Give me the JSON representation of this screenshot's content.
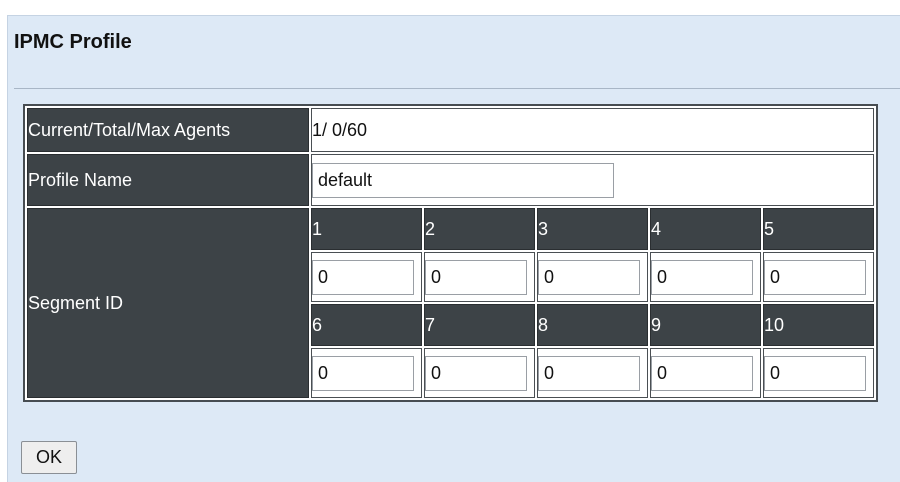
{
  "page": {
    "title": "IPMC Profile"
  },
  "table": {
    "agents_label": "Current/Total/Max Agents",
    "agents_value": "1/ 0/60",
    "profile_name_label": "Profile Name",
    "profile_name_value": "default",
    "segment_label": "Segment ID",
    "segments_row1": [
      {
        "id": "1",
        "value": "0"
      },
      {
        "id": "2",
        "value": "0"
      },
      {
        "id": "3",
        "value": "0"
      },
      {
        "id": "4",
        "value": "0"
      },
      {
        "id": "5",
        "value": "0"
      }
    ],
    "segments_row2": [
      {
        "id": "6",
        "value": "0"
      },
      {
        "id": "7",
        "value": "0"
      },
      {
        "id": "8",
        "value": "0"
      },
      {
        "id": "9",
        "value": "0"
      },
      {
        "id": "10",
        "value": "0"
      }
    ]
  },
  "actions": {
    "ok_label": "OK"
  }
}
